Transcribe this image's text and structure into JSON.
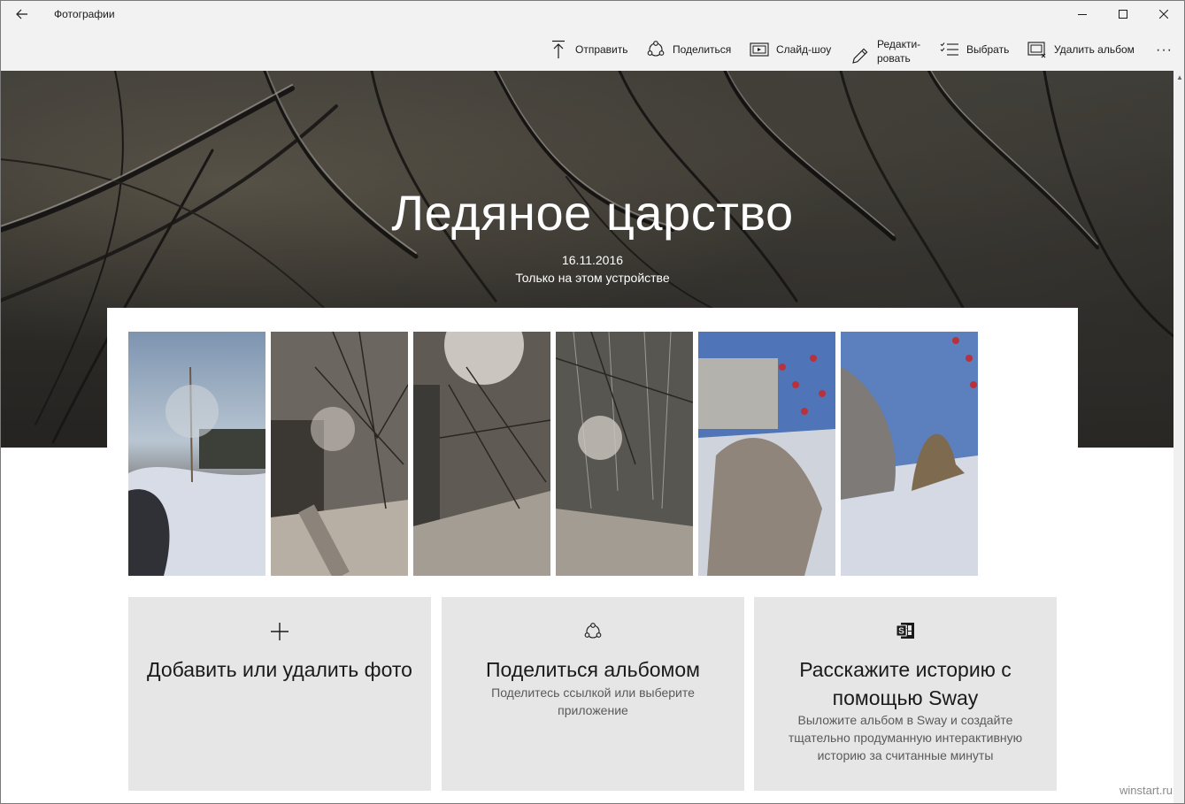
{
  "window": {
    "title": "Фотографии"
  },
  "toolbar": {
    "send": "Отправить",
    "share": "Поделиться",
    "slideshow": "Слайд-шоу",
    "edit_line1": "Редакти-",
    "edit_line2": "ровать",
    "select": "Выбрать",
    "delete_album": "Удалить альбом",
    "more": "···"
  },
  "album": {
    "title": "Ледяное царство",
    "date": "16.11.2016",
    "location": "Только на этом устройстве"
  },
  "photos": [
    {
      "id": "p1",
      "icon": "photo-thumbnail"
    },
    {
      "id": "p2",
      "icon": "photo-thumbnail"
    },
    {
      "id": "p3",
      "icon": "photo-thumbnail"
    },
    {
      "id": "p4",
      "icon": "photo-thumbnail"
    },
    {
      "id": "p5",
      "icon": "photo-thumbnail"
    },
    {
      "id": "p6",
      "icon": "photo-thumbnail"
    }
  ],
  "cards": {
    "add": {
      "title": "Добавить или удалить фото",
      "icon": "plus-icon"
    },
    "share": {
      "title": "Поделиться альбомом",
      "desc": "Поделитесь ссылкой или выберите приложение",
      "icon": "share-icon"
    },
    "sway": {
      "title": "Расскажите историю с помощью Sway",
      "desc": "Выложите альбом в Sway и создайте тщательно продуманную интерактивную историю за считанные минуты",
      "icon": "sway-icon"
    }
  },
  "watermark": "winstart.ru",
  "colors": {
    "chrome": "#f2f2f2",
    "card": "#e6e6e6",
    "text": "#1a1a1a",
    "muted": "#5a5a5a"
  }
}
